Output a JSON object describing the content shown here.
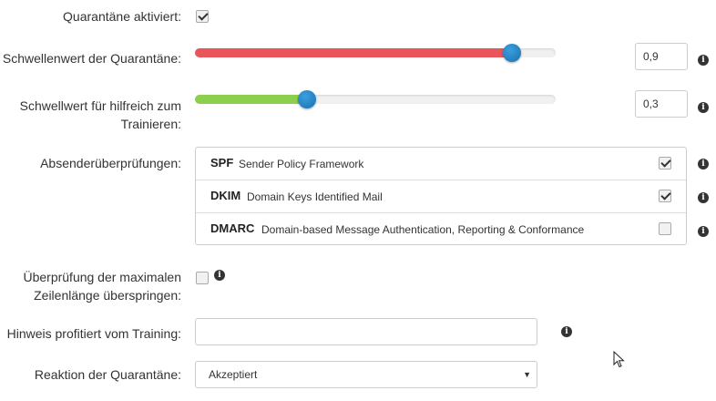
{
  "quarantine": {
    "label": "Quarantäne aktiviert:",
    "checked": true
  },
  "threshold": {
    "label": "Schwellenwert der Quarantäne:",
    "value": "0,9",
    "fraction": 0.9,
    "fill_color": "#e8555a"
  },
  "helpful_threshold": {
    "label_line1": "Schwellwert für hilfreich zum",
    "label_line2": "Trainieren:",
    "value": "0,3",
    "fraction": 0.3,
    "fill_color": "#8ccf4d"
  },
  "sender_checks": {
    "label": "Absenderüberprüfungen:",
    "items": [
      {
        "abbr": "SPF",
        "desc": "Sender Policy Framework",
        "checked": true
      },
      {
        "abbr": "DKIM",
        "desc": "Domain Keys Identified Mail",
        "checked": true
      },
      {
        "abbr": "DMARC",
        "desc": "Domain-based Message Authentication, Reporting & Conformance",
        "checked": false
      }
    ]
  },
  "skip_line_length": {
    "label_line1": "Überprüfung der maximalen",
    "label_line2": "Zeilenlänge überspringen:",
    "checked": false
  },
  "hint_training": {
    "label": "Hinweis profitiert vom Training:",
    "value": ""
  },
  "reaction": {
    "label": "Reaktion der Quarantäne:",
    "selected": "Akzeptiert"
  },
  "icons": {
    "info": "info-icon",
    "checkmark": "checkmark-icon",
    "dropdown": "chevron-down-icon",
    "cursor": "mouse-pointer-icon"
  },
  "info_glyph": "i",
  "select_caret": "▼"
}
